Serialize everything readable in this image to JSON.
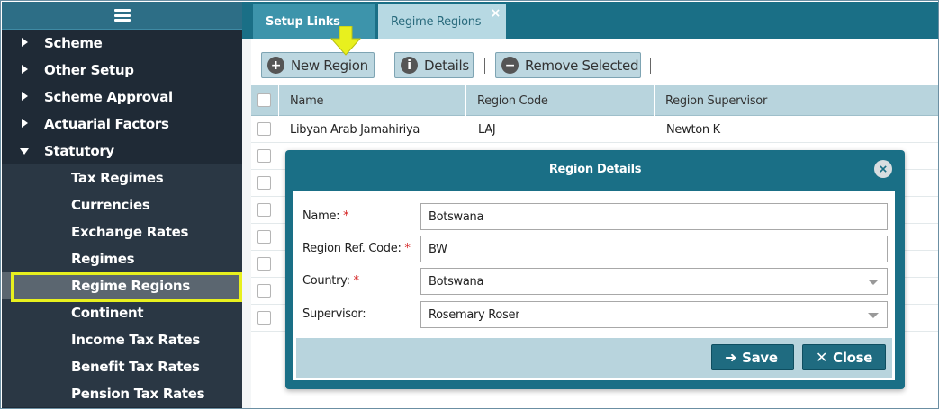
{
  "sidebar": {
    "menu_icon": "hamburger-menu-icon",
    "items": [
      {
        "label": "Scheme",
        "expanded": false
      },
      {
        "label": "Other Setup",
        "expanded": false
      },
      {
        "label": "Scheme Approval",
        "expanded": false
      },
      {
        "label": "Actuarial Factors",
        "expanded": false
      },
      {
        "label": "Statutory",
        "expanded": true
      }
    ],
    "children": [
      {
        "label": "Tax Regimes"
      },
      {
        "label": "Currencies"
      },
      {
        "label": "Exchange Rates"
      },
      {
        "label": "Regimes"
      },
      {
        "label": "Regime Regions",
        "active": true
      },
      {
        "label": "Continent"
      },
      {
        "label": "Income Tax Rates"
      },
      {
        "label": "Benefit Tax Rates"
      },
      {
        "label": "Pension Tax Rates"
      }
    ]
  },
  "tabs": [
    {
      "label": "Setup Links"
    },
    {
      "label": "Regime Regions",
      "closable": true,
      "close_glyph": "×"
    }
  ],
  "toolbar": {
    "new_label": "New Region",
    "new_icon_glyph": "+",
    "details_label": "Details",
    "details_icon_glyph": "i",
    "remove_label": "Remove Selected",
    "remove_icon_glyph": "−"
  },
  "grid": {
    "columns": [
      "Name",
      "Region Code",
      "Region Supervisor"
    ],
    "rows": [
      {
        "name": "Libyan Arab Jamahiriya",
        "code": "LAJ",
        "supervisor": "Newton K"
      },
      {
        "name": "",
        "code": "",
        "supervisor": ""
      },
      {
        "name": "",
        "code": "",
        "supervisor": ""
      },
      {
        "name": "",
        "code": "",
        "supervisor": ""
      },
      {
        "name": "",
        "code": "",
        "supervisor": ""
      },
      {
        "name": "",
        "code": "",
        "supervisor": ""
      },
      {
        "name": "",
        "code": "",
        "supervisor": ""
      },
      {
        "name": "",
        "code": "",
        "supervisor": ""
      }
    ]
  },
  "modal": {
    "title": "Region Details",
    "close_glyph": "×",
    "fields": {
      "name": {
        "label": "Name:",
        "required_mark": "*",
        "value": "Botswana"
      },
      "ref_code": {
        "label": "Region Ref. Code:",
        "required_mark": "*",
        "value": "BW"
      },
      "country": {
        "label": "Country:",
        "required_mark": "*",
        "value": "Botswana"
      },
      "supervisor": {
        "label": "Supervisor:",
        "value": "Rosemary Rosemary"
      }
    },
    "save_label": "Save",
    "save_icon_glyph": "➜",
    "close_label": "Close",
    "close_icon_glyph": "✕"
  },
  "colors": {
    "accent": "#1a6f86",
    "sidebar_bg": "#1f2a36",
    "highlight": "#e8f01e",
    "required": "#d42020"
  }
}
